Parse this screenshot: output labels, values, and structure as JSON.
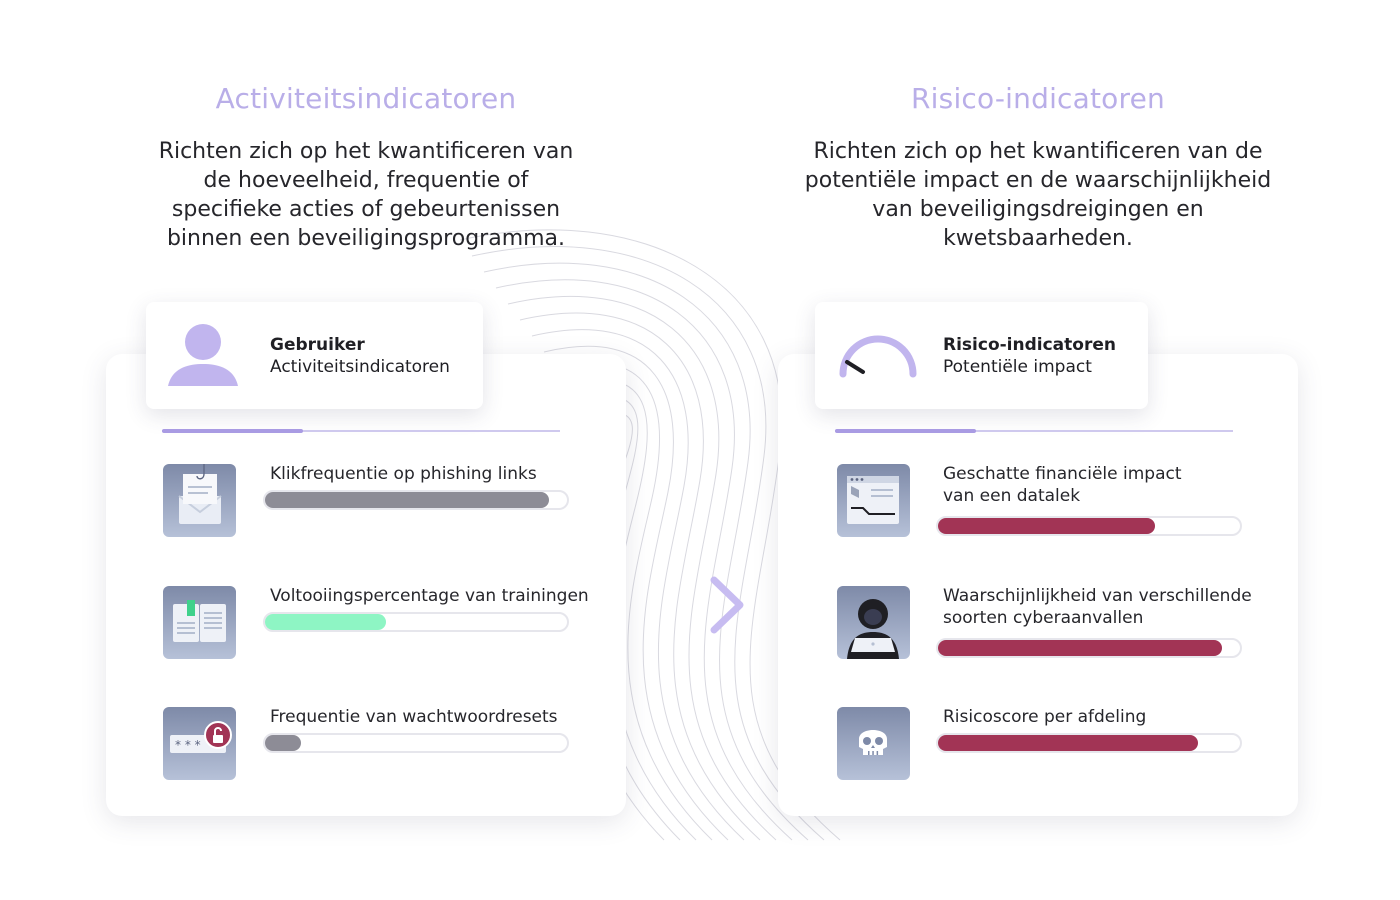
{
  "left": {
    "title": "Activiteitsindicatoren",
    "description": "Richten zich op het kwantificeren van de hoeveelheid, frequentie of specifieke acties of gebeurtenissen binnen een beveiligingsprogramma.",
    "tag": {
      "title": "Gebruiker",
      "subtitle": "Activiteitsindicatoren",
      "icon": "user-icon"
    },
    "items": [
      {
        "label": "Klikfrequentie op phishing links",
        "icon": "phishing-email-icon",
        "value": 0.94,
        "color": "#8d8c96"
      },
      {
        "label": "Voltooiingspercentage van trainingen",
        "icon": "training-book-icon",
        "value": 0.4,
        "color": "#8ef5c4"
      },
      {
        "label": "Frequentie van wachtwoordresets",
        "icon": "password-reset-icon",
        "value": 0.12,
        "color": "#8d8c96"
      }
    ]
  },
  "right": {
    "title": "Risico-indicatoren",
    "description": "Richten zich op het kwantificeren van de potentiële impact en de waarschijnlijkheid van beveiligingsdreigingen en kwetsbaarheden.",
    "tag": {
      "title": "Risico-indicatoren",
      "subtitle": "Potentiële impact",
      "icon": "gauge-icon"
    },
    "items": [
      {
        "label1": "Geschatte financiële impact",
        "label2": "van een datalek",
        "icon": "data-breach-chart-icon",
        "value": 0.72,
        "color": "#a23455"
      },
      {
        "label1": "Waarschijnlijkheid van verschillende",
        "label2": "soorten cyberaanvallen",
        "icon": "hacker-icon",
        "value": 0.94,
        "color": "#a23455"
      },
      {
        "label1": "Risicoscore per afdeling",
        "label2": "",
        "icon": "skull-icon",
        "value": 0.86,
        "color": "#a23455"
      }
    ]
  },
  "colors": {
    "accent": "#b9aee8",
    "risk": "#a23455",
    "training": "#8ef5c4",
    "neutral": "#8d8c96"
  }
}
